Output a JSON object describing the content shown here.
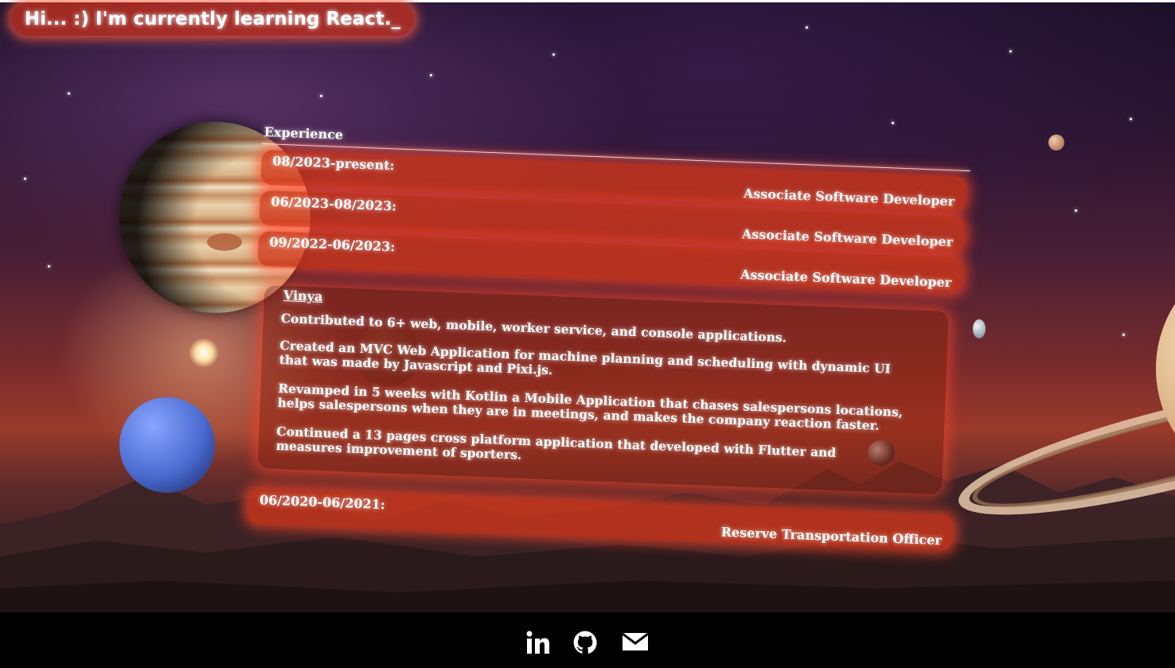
{
  "greeting": "Hi... :) I'm currently learning React._",
  "experience": {
    "title": "Experience",
    "jobs": [
      {
        "date": "08/2023-present:",
        "role": "Associate Software Developer"
      },
      {
        "date": "06/2023-08/2023:",
        "role": "Associate Software Developer"
      },
      {
        "date": "09/2022-06/2023:",
        "role": "Associate Software Developer"
      }
    ],
    "detail": {
      "company": "Vinya",
      "items": [
        "Contributed to 6+ web, mobile, worker service, and console applications.",
        "Created an MVC Web Application for machine planning and scheduling with dynamic UI that was made by Javascript and Pixi.js.",
        "Revamped in 5 weeks with Kotlin a Mobile Application that chases salespersons locations, helps salespersons when they are in meetings, and makes the company reaction faster.",
        "Continued a 13 pages cross platform application that developed with Flutter and measures improvement of sporters."
      ]
    },
    "last_job": {
      "date": "06/2020-06/2021:",
      "role": "Reserve Transportation Officer"
    }
  },
  "footer": {
    "icons": [
      "linkedin-icon",
      "github-icon",
      "mail-icon"
    ]
  }
}
